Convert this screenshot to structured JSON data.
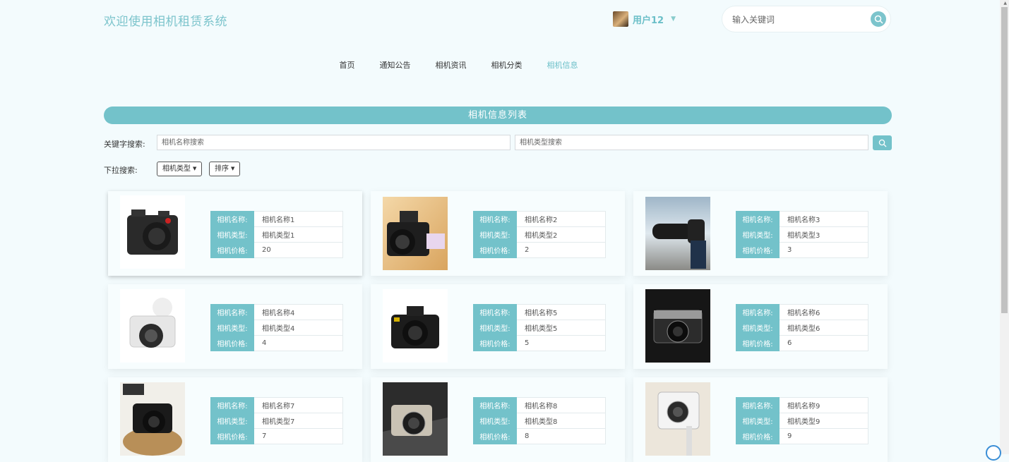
{
  "header": {
    "site_title": "欢迎使用相机租赁系统",
    "user_name": "用户12",
    "search_placeholder": "输入关键词"
  },
  "nav": {
    "items": [
      "首页",
      "通知公告",
      "相机资讯",
      "相机分类",
      "相机信息"
    ],
    "active_index": 4
  },
  "section_title": "相机信息列表",
  "filters": {
    "keyword_label": "关键字搜索:",
    "name_placeholder": "相机名称搜索",
    "type_placeholder": "相机类型搜索",
    "dropdown_label": "下拉搜索:",
    "type_dropdown": "相机类型",
    "sort_dropdown": "排序"
  },
  "field_labels": {
    "name": "相机名称:",
    "type": "相机类型:",
    "price": "相机价格:"
  },
  "products": [
    {
      "name": "相机名称1",
      "type": "相机类型1",
      "price": "20"
    },
    {
      "name": "相机名称2",
      "type": "相机类型2",
      "price": "2"
    },
    {
      "name": "相机名称3",
      "type": "相机类型3",
      "price": "3"
    },
    {
      "name": "相机名称4",
      "type": "相机类型4",
      "price": "4"
    },
    {
      "name": "相机名称5",
      "type": "相机类型5",
      "price": "5"
    },
    {
      "name": "相机名称6",
      "type": "相机类型6",
      "price": "6"
    },
    {
      "name": "相机名称7",
      "type": "相机类型7",
      "price": "7"
    },
    {
      "name": "相机名称8",
      "type": "相机类型8",
      "price": "8"
    },
    {
      "name": "相机名称9",
      "type": "相机类型9",
      "price": "9"
    }
  ],
  "colors": {
    "accent": "#73c2ca",
    "background": "#f3fbfd"
  },
  "icons": {
    "search": "search-icon",
    "caret": "chevron-down-icon"
  }
}
